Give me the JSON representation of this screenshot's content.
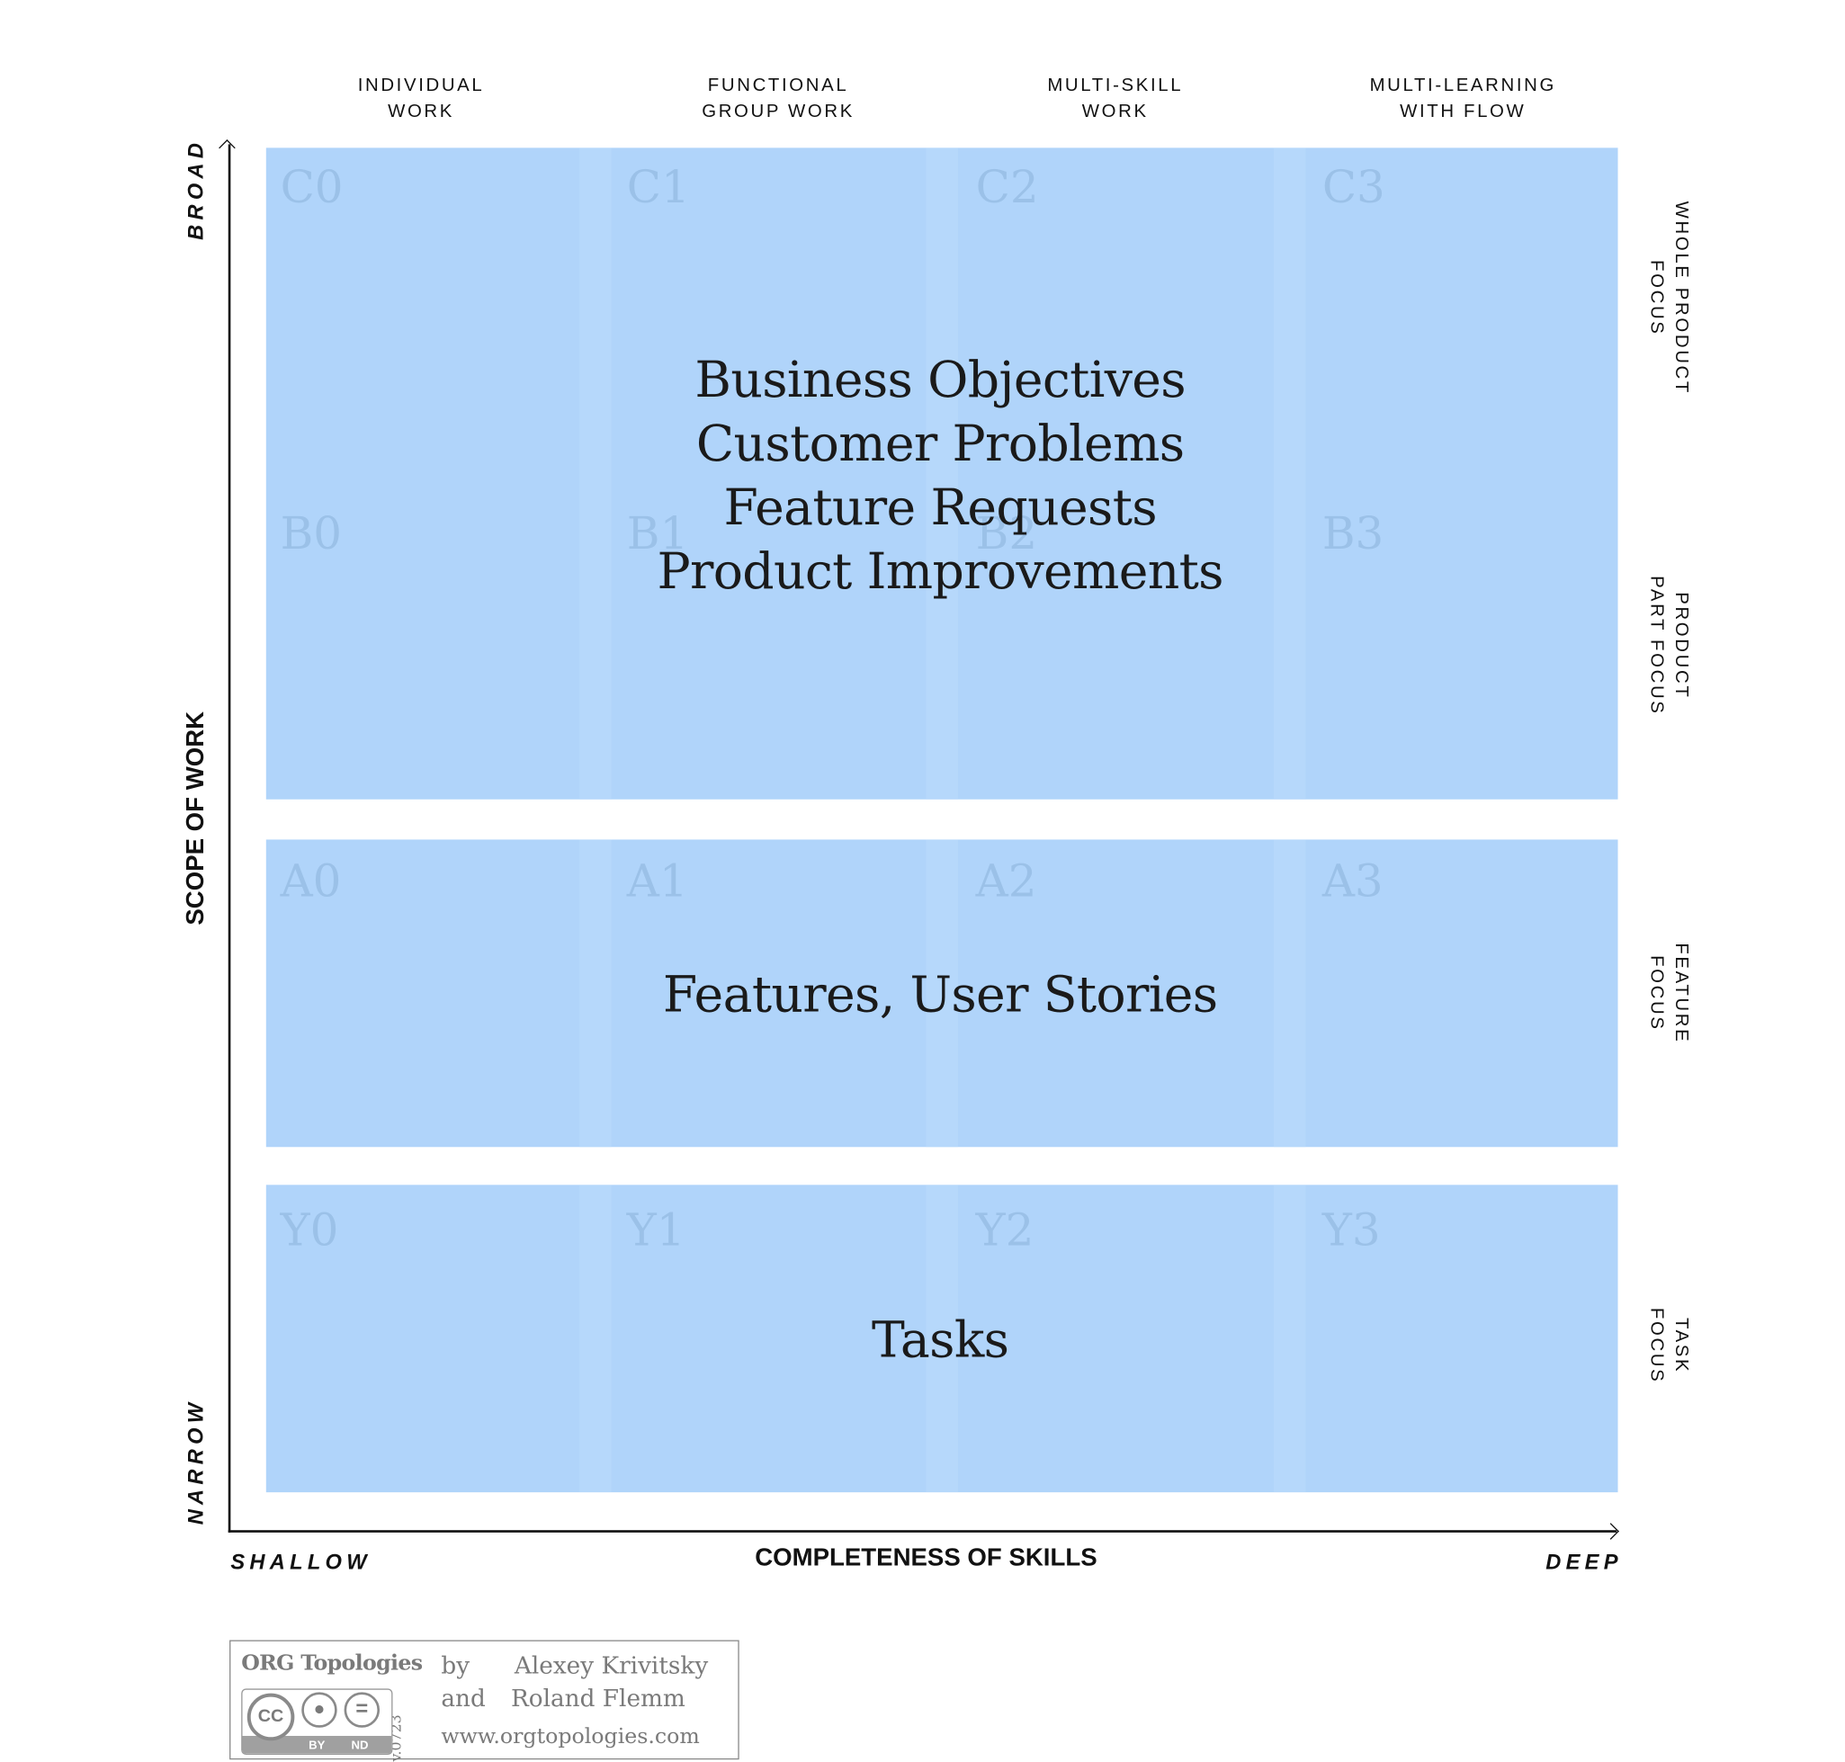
{
  "columns": [
    {
      "line1": "INDIVIDUAL",
      "line2": "WORK"
    },
    {
      "line1": "FUNCTIONAL",
      "line2": "GROUP WORK"
    },
    {
      "line1": "MULTI-SKILL",
      "line2": "WORK"
    },
    {
      "line1": "MULTI-LEARNING",
      "line2": "WITH FLOW"
    }
  ],
  "rows": [
    {
      "line1": "WHOLE PRODUCT",
      "line2": "FOCUS"
    },
    {
      "line1": "PRODUCT",
      "line2": "PART FOCUS"
    },
    {
      "line1": "FEATURE",
      "line2": "FOCUS"
    },
    {
      "line1": "TASK",
      "line2": "FOCUS"
    }
  ],
  "axes": {
    "y_title": "SCOPE OF WORK",
    "y_high": "BROAD",
    "y_low": "NARROW",
    "x_title": "COMPLETENESS OF SKILLS",
    "x_low": "SHALLOW",
    "x_high": "DEEP"
  },
  "cells": {
    "C": [
      "C0",
      "C1",
      "C2",
      "C3"
    ],
    "B": [
      "B0",
      "B1",
      "B2",
      "B3"
    ],
    "A": [
      "A0",
      "A1",
      "A2",
      "A3"
    ],
    "Y": [
      "Y0",
      "Y1",
      "Y2",
      "Y3"
    ]
  },
  "blocks": {
    "top": [
      "Business Objectives",
      "Customer Problems",
      "Feature Requests",
      "Product Improvements"
    ],
    "middle": "Features, User Stories",
    "bottom": "Tasks"
  },
  "colors": {
    "block": "#b0d4fa",
    "cell_label": "#9bc1e8",
    "text": "#1a1a1a"
  },
  "footer": {
    "brand": "ORG Topologies",
    "by": "by",
    "and": "and",
    "author1": "Alexey Krivitsky",
    "author2": "Roland Flemm",
    "url": "www.orgtopologies.com",
    "version": "v.0723",
    "license": "CC",
    "license_by": "BY",
    "license_nd": "ND"
  }
}
